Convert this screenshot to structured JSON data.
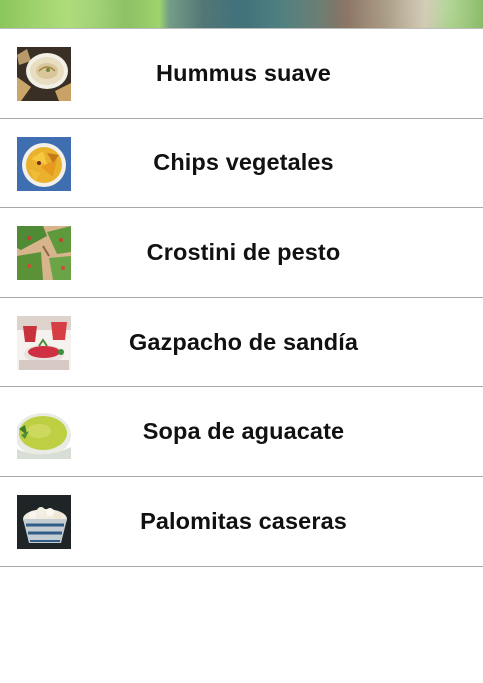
{
  "recipes": [
    {
      "name": "Hummus suave",
      "icon": "hummus-thumbnail"
    },
    {
      "name": "Chips vegetales",
      "icon": "veggie-chips-thumbnail"
    },
    {
      "name": "Crostini de pesto",
      "icon": "pesto-crostini-thumbnail"
    },
    {
      "name": "Gazpacho de sandía",
      "icon": "watermelon-gazpacho-thumbnail"
    },
    {
      "name": "Sopa de aguacate",
      "icon": "avocado-soup-thumbnail"
    },
    {
      "name": "Palomitas caseras",
      "icon": "popcorn-thumbnail"
    }
  ]
}
